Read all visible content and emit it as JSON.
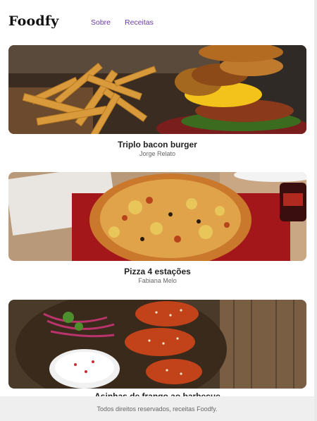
{
  "header": {
    "logo": "Foodfy",
    "nav": [
      {
        "label": "Sobre"
      },
      {
        "label": "Receitas"
      }
    ]
  },
  "recipes": [
    {
      "title": "Triplo bacon burger",
      "author": "Jorge Relato"
    },
    {
      "title": "Pizza 4 estações",
      "author": "Fabiana Melo"
    },
    {
      "title": "Asinhas de frango ao barbecue",
      "author": ""
    }
  ],
  "footer": {
    "text": "Todos direitos reservados, receitas Foodfy."
  }
}
